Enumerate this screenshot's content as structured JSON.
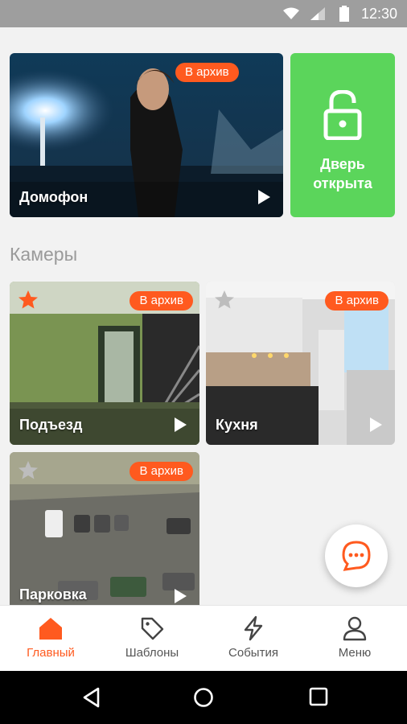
{
  "status_bar": {
    "time": "12:30"
  },
  "intercom": {
    "label": "Домофон",
    "badge": "В архив"
  },
  "door": {
    "line1": "Дверь",
    "line2": "открыта"
  },
  "cameras_title": "Камеры",
  "cameras": [
    {
      "label": "Подъезд",
      "badge": "В архив",
      "favorite": true
    },
    {
      "label": "Кухня",
      "badge": "В архив",
      "favorite": false
    },
    {
      "label": "Парковка",
      "badge": "В архив",
      "favorite": false
    }
  ],
  "nav": [
    {
      "label": "Главный",
      "icon": "home-icon",
      "active": true
    },
    {
      "label": "Шаблоны",
      "icon": "tag-icon",
      "active": false
    },
    {
      "label": "События",
      "icon": "lightning-icon",
      "active": false
    },
    {
      "label": "Меню",
      "icon": "user-icon",
      "active": false
    }
  ],
  "colors": {
    "accent": "#ff5a1f",
    "door_open": "#5bd55b",
    "status_bar": "#9e9e9e"
  }
}
